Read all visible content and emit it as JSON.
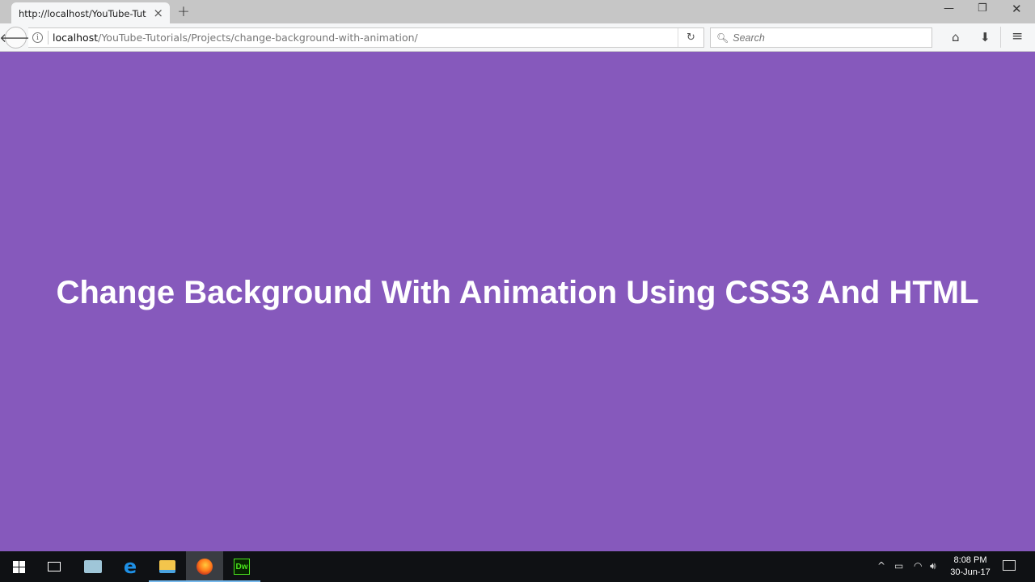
{
  "browser": {
    "tab": {
      "title": "http://localhost/YouTube-Tutorials/Projects/change-background-with-animation/",
      "close_icon": "×"
    },
    "new_tab_icon": "+",
    "window_controls": {
      "minimize": "—",
      "maximize": "❐",
      "close": "✕"
    },
    "back_icon": "🡐",
    "info_icon": "i",
    "url": {
      "host": "localhost",
      "path": "/YouTube-Tutorials/Projects/change-background-with-animation/"
    },
    "reload_icon": "↻",
    "search": {
      "placeholder": "Search",
      "icon": "🔍︎"
    },
    "toolbar": {
      "home_icon": "⌂",
      "download_icon": "⬇",
      "menu_icon": "≡"
    }
  },
  "page": {
    "heading": "Change Background With Animation Using CSS3 And HTML",
    "background_color": "#8659bc",
    "text_color": "#ffffff"
  },
  "taskbar": {
    "apps": [
      "start",
      "task-view",
      "store",
      "edge",
      "file-explorer",
      "firefox",
      "dreamweaver"
    ],
    "dreamweaver_label": "Dw",
    "edge_label": "e",
    "tray": {
      "chevron": "^",
      "battery": "▭",
      "wifi": "◠",
      "volume": "🔊︎"
    },
    "time": "8:08 PM",
    "date": "30-Jun-17"
  }
}
